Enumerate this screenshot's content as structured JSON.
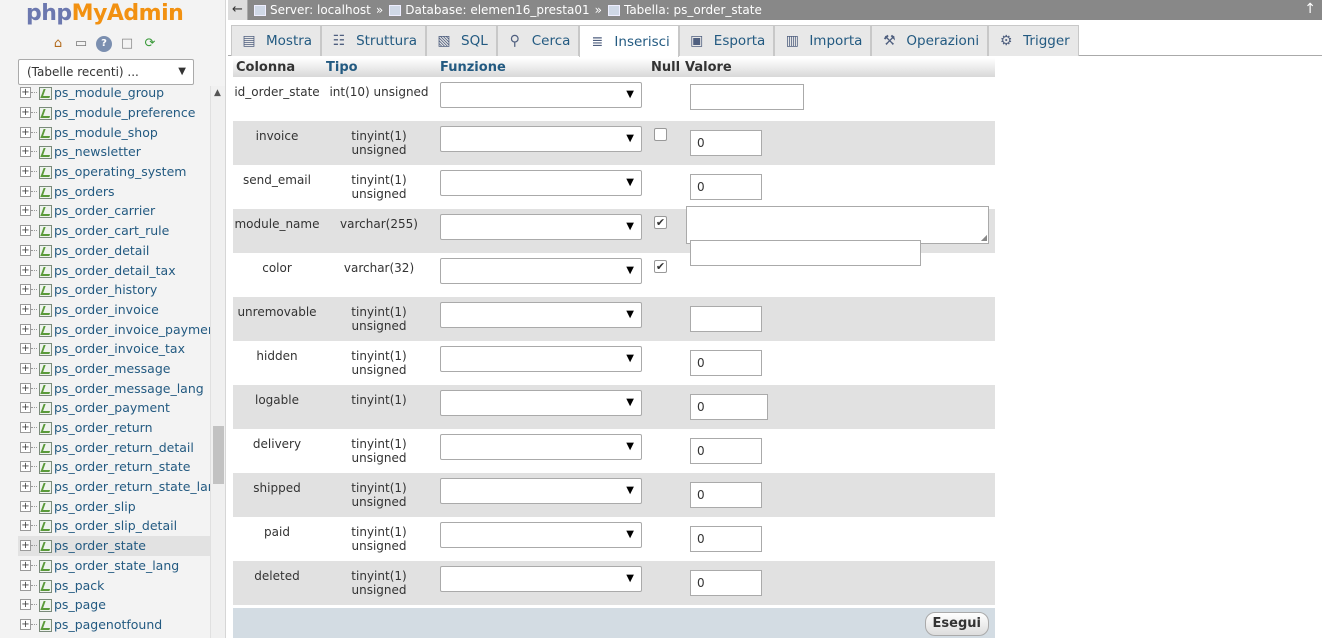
{
  "logo": {
    "php": "php",
    "my": "My",
    "admin": "Admin"
  },
  "nav_icons": [
    "home-icon",
    "exit-icon",
    "help-icon",
    "docs-icon",
    "reload-icon"
  ],
  "recent_tables": {
    "label": "(Tabelle recenti) ..."
  },
  "tree": {
    "items": [
      "ps_module_group",
      "ps_module_preference",
      "ps_module_shop",
      "ps_newsletter",
      "ps_operating_system",
      "ps_orders",
      "ps_order_carrier",
      "ps_order_cart_rule",
      "ps_order_detail",
      "ps_order_detail_tax",
      "ps_order_history",
      "ps_order_invoice",
      "ps_order_invoice_payment",
      "ps_order_invoice_tax",
      "ps_order_message",
      "ps_order_message_lang",
      "ps_order_payment",
      "ps_order_return",
      "ps_order_return_detail",
      "ps_order_return_state",
      "ps_order_return_state_lang",
      "ps_order_slip",
      "ps_order_slip_detail",
      "ps_order_state",
      "ps_order_state_lang",
      "ps_pack",
      "ps_page",
      "ps_pagenotfound"
    ],
    "selected": "ps_order_state"
  },
  "breadcrumb": {
    "server": "Server: localhost",
    "database": "Database: elemen16_presta01",
    "table": "Tabella: ps_order_state",
    "sep": "»"
  },
  "tabs": [
    {
      "label": "Mostra",
      "icon": "browse-icon"
    },
    {
      "label": "Struttura",
      "icon": "structure-icon"
    },
    {
      "label": "SQL",
      "icon": "sql-icon"
    },
    {
      "label": "Cerca",
      "icon": "search-icon"
    },
    {
      "label": "Inserisci",
      "icon": "insert-icon",
      "active": true
    },
    {
      "label": "Esporta",
      "icon": "export-icon"
    },
    {
      "label": "Importa",
      "icon": "import-icon"
    },
    {
      "label": "Operazioni",
      "icon": "wrench-icon"
    },
    {
      "label": "Trigger",
      "icon": "trigger-icon"
    }
  ],
  "form": {
    "headers": {
      "column": "Colonna",
      "type": "Tipo",
      "function": "Funzione",
      "null": "Null",
      "value": "Valore"
    },
    "rows": [
      {
        "column": "id_order_state",
        "type": "int(10) unsigned",
        "null": null,
        "value": ""
      },
      {
        "column": "invoice",
        "type": "tinyint(1) unsigned",
        "null": false,
        "value": "0"
      },
      {
        "column": "send_email",
        "type": "tinyint(1) unsigned",
        "null": null,
        "value": "0"
      },
      {
        "column": "module_name",
        "type": "varchar(255)",
        "null": true,
        "value": ""
      },
      {
        "column": "color",
        "type": "varchar(32)",
        "null": true,
        "value": ""
      },
      {
        "column": "unremovable",
        "type": "tinyint(1) unsigned",
        "null": null,
        "value": ""
      },
      {
        "column": "hidden",
        "type": "tinyint(1) unsigned",
        "null": null,
        "value": "0"
      },
      {
        "column": "logable",
        "type": "tinyint(1)",
        "null": null,
        "value": "0"
      },
      {
        "column": "delivery",
        "type": "tinyint(1) unsigned",
        "null": null,
        "value": "0"
      },
      {
        "column": "shipped",
        "type": "tinyint(1) unsigned",
        "null": null,
        "value": "0"
      },
      {
        "column": "paid",
        "type": "tinyint(1) unsigned",
        "null": null,
        "value": "0"
      },
      {
        "column": "deleted",
        "type": "tinyint(1) unsigned",
        "null": null,
        "value": "0"
      }
    ],
    "go_button": "Esegui"
  }
}
